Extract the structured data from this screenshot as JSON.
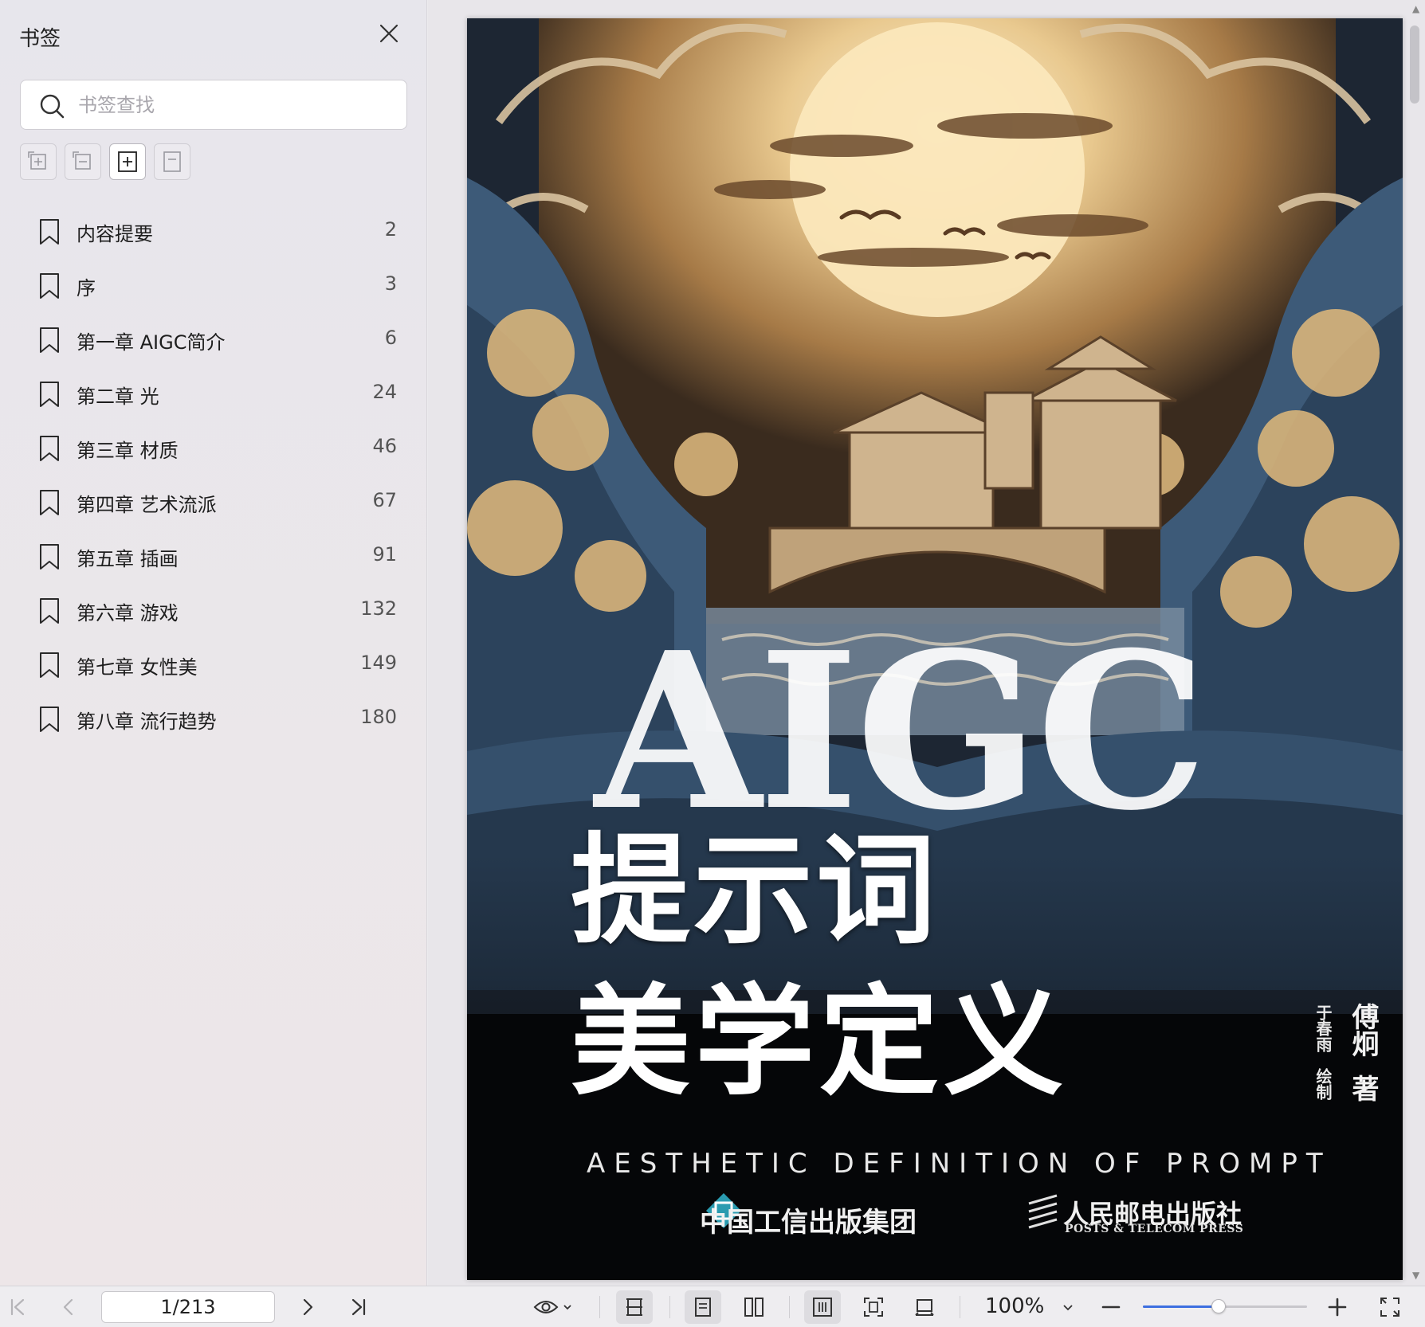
{
  "sidebar": {
    "title": "书签",
    "search_placeholder": "书签查找",
    "items": [
      {
        "label": "内容提要",
        "page": "2"
      },
      {
        "label": "序",
        "page": "3"
      },
      {
        "label": "第一章 AIGC简介",
        "page": "6"
      },
      {
        "label": "第二章 光",
        "page": "24"
      },
      {
        "label": "第三章 材质",
        "page": "46"
      },
      {
        "label": "第四章 艺术流派",
        "page": "67"
      },
      {
        "label": "第五章 插画",
        "page": "91"
      },
      {
        "label": "第六章 游戏",
        "page": "132"
      },
      {
        "label": "第七章 女性美",
        "page": "149"
      },
      {
        "label": "第八章 流行趋势",
        "page": "180"
      }
    ]
  },
  "cover": {
    "brand": "AIGC",
    "title_line1": "提示词",
    "title_line2": "美学定义",
    "subtitle": "AESTHETIC DEFINITION OF PROMPT",
    "author1_name": "傅炯",
    "author1_role": "著",
    "author2_name": "于春雨",
    "author2_role": "绘制",
    "publisher1": "中国工信出版集团",
    "publisher2": "人民邮电出版社",
    "publisher2_en": "POSTS & TELECOM PRESS"
  },
  "toolbar": {
    "page_value": "1/213",
    "zoom": "100%",
    "zoom_fraction": 0.46
  },
  "colors": {
    "accent": "#3d6fe0",
    "sidebar_bg": "#e7e6ec",
    "cover_gold": "#d8b47a",
    "cover_blue": "#3d5a78"
  }
}
